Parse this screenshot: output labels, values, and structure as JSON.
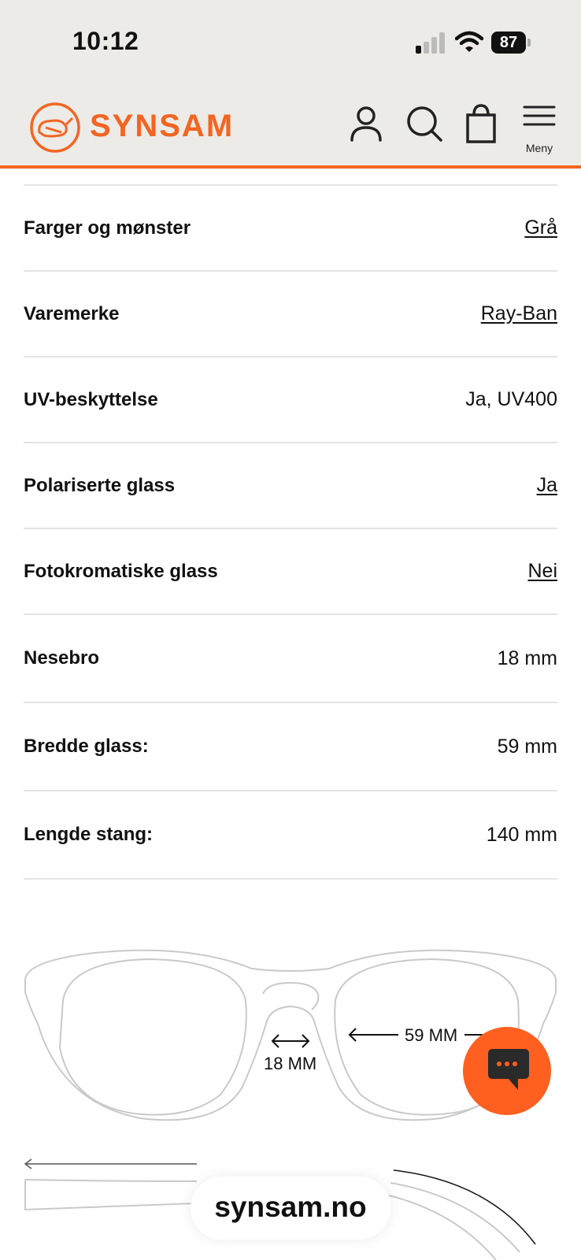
{
  "status": {
    "time": "10:12",
    "battery": "87"
  },
  "header": {
    "brand": "SYNSAM",
    "menu_label": "Meny",
    "brand_color": "#F26522"
  },
  "specs": [
    {
      "label": "Farger og mønster",
      "value": "Grå",
      "link": true
    },
    {
      "label": "Varemerke",
      "value": "Ray-Ban",
      "link": true
    },
    {
      "label": "UV-beskyttelse",
      "value": "Ja, UV400",
      "link": false
    },
    {
      "label": "Polariserte glass",
      "value": "Ja",
      "link": true
    },
    {
      "label": "Fotokromatiske glass",
      "value": "Nei",
      "link": true
    },
    {
      "label": "Nesebro",
      "value": "18 mm",
      "link": false
    },
    {
      "label": "Bredde glass:",
      "value": "59 mm",
      "link": false
    },
    {
      "label": "Lengde stang:",
      "value": "140 mm",
      "link": false
    }
  ],
  "diagram": {
    "bridge_label": "18 MM",
    "lens_label": "59 MM"
  },
  "browser": {
    "url": "synsam.no"
  }
}
